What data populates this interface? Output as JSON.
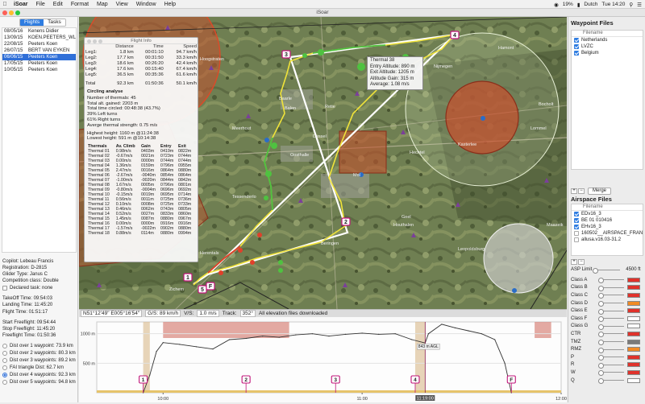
{
  "menubar": {
    "app": "iSoar",
    "items": [
      "File",
      "Edit",
      "Format",
      "Map",
      "View",
      "Window",
      "Help"
    ],
    "status": {
      "battery": "19%",
      "input": "Dutch",
      "clock": "Tue 14:20"
    }
  },
  "window": {
    "title": "iSoar"
  },
  "left": {
    "tabs": [
      "Flights",
      "Tasks"
    ],
    "active_tab": "Flights",
    "flights": [
      {
        "date": "08/05/16",
        "pilot": "Kenens Didier"
      },
      {
        "date": "13/09/15",
        "pilot": "KOEN.PEETERS_WL"
      },
      {
        "date": "22/08/15",
        "pilot": "Peeters Koen"
      },
      {
        "date": "26/07/15",
        "pilot": "BERT VAN EYKEN"
      },
      {
        "date": "06/06/15",
        "pilot": "Peeters Koen"
      },
      {
        "date": "17/05/15",
        "pilot": "Peeters Koen"
      },
      {
        "date": "10/05/15",
        "pilot": "Peeters Koen"
      }
    ],
    "selected_index": 4,
    "details": {
      "copilot": "Copilot: Lebeau Francis",
      "registration": "Registration: D-2815",
      "glider": "Glider Type: Janus C",
      "competition": "Competition class: Double",
      "declared": "Declared task: none",
      "takeoff": "TakeOff Time: 09:54:03",
      "landing": "Landing Time: 11:45:20",
      "flight_time": "Flight Time: 01:51:17",
      "start_ff": "Start Freeflight: 09:54:44",
      "stop_ff": "Stop Freeflight: 11:45:20",
      "ff_time": "Freeflight Time: 01:50:36"
    },
    "options": [
      {
        "label": "Dist over 1 waypoint: 73.9 km",
        "selected": false
      },
      {
        "label": "Dist over 2 waypoints: 80.3 km",
        "selected": false
      },
      {
        "label": "Dist over 3 waypoints: 89.2 km",
        "selected": false
      },
      {
        "label": "FAI triangle Dist: 62.7 km",
        "selected": false
      },
      {
        "label": "Dist over 4 waypoints: 92.3 km",
        "selected": true
      },
      {
        "label": "Dist over 5 waypoints: 94.8 km",
        "selected": false
      }
    ]
  },
  "flight_info": {
    "title": "Flight Info",
    "legs_header": [
      "",
      "Distance",
      "Time",
      "Speed"
    ],
    "legs": [
      [
        "Leg1:",
        "1.8 km",
        "00:01:10",
        "94.7 km/h"
      ],
      [
        "Leg2:",
        "17.7 km",
        "00:31:50",
        "33.3 km/h"
      ],
      [
        "Leg3:",
        "18.6 km",
        "00:26:20",
        "42.4 km/h"
      ],
      [
        "Leg4:",
        "17.6 km",
        "00:15:40",
        "67.4 km/h"
      ],
      [
        "Leg5:",
        "36.5 km",
        "00:35:36",
        "61.6 km/h"
      ]
    ],
    "total": [
      "Total",
      "92.3 km",
      "01:50:36",
      "50.1 km/h"
    ],
    "circling": {
      "heading": "Circling analyse",
      "lines": [
        "Number of thermals: 45",
        "Total alt. gained: 2203 m",
        "Total time circled: 00:48:38 (43.7%)",
        "39% Left turns",
        "61% Right turns",
        "Averge thermal strength: 0.75 m/s"
      ],
      "heights": [
        "Highest height: 1160 m @11:24:38",
        "Lowest height: 591 m @10:14:38"
      ]
    },
    "thermals_header": [
      "Thermals",
      "Av. Climb",
      "Gain",
      "Entry",
      "Exit"
    ],
    "thermals": [
      [
        "Thermal 01",
        "0.98m/s",
        "0403m",
        "0419m",
        "0822m"
      ],
      [
        "Thermal 02",
        "-0.67m/s",
        "0021m",
        "0723m",
        "0744m"
      ],
      [
        "Thermal 03",
        "0.00m/s",
        "0000m",
        "0744m",
        "0744m"
      ],
      [
        "Thermal 04",
        "1.36m/s",
        "0159m",
        "0796m",
        "0955m"
      ],
      [
        "Thermal 05",
        "2.47m/s",
        "0016m",
        "0864m",
        "0880m"
      ],
      [
        "Thermal 06",
        "-2.67m/s",
        "-0040m",
        "0854m",
        "0864m"
      ],
      [
        "Thermal 07",
        "-1.00m/s",
        "-0020m",
        "0844m",
        "0842m"
      ],
      [
        "Thermal 08",
        "1.67m/s",
        "0005m",
        "0796m",
        "0801m"
      ],
      [
        "Thermal 09",
        "-0.80m/s",
        "-0004m",
        "0696m",
        "0692m"
      ],
      [
        "Thermal 10",
        "-0.15m/s",
        "0019m",
        "0695m",
        "0714m"
      ],
      [
        "Thermal 11",
        "0.56m/s",
        "0011m",
        "0725m",
        "0736m"
      ],
      [
        "Thermal 12",
        "0.10m/s",
        "0008m",
        "0725m",
        "0733m"
      ],
      [
        "Thermal 13",
        "0.46m/s",
        "0062m",
        "0743m",
        "0805m"
      ],
      [
        "Thermal 14",
        "0.52m/s",
        "0027m",
        "0833m",
        "0860m"
      ],
      [
        "Thermal 15",
        "1.45m/s",
        "0087m",
        "0880m",
        "0967m"
      ],
      [
        "Thermal 16",
        "0.00m/s",
        "0000m",
        "0916m",
        "0916m"
      ],
      [
        "Thermal 17",
        "-1.57m/s",
        "-0022m",
        "0902m",
        "0880m"
      ],
      [
        "Thermal 18",
        "0.88m/s",
        "0114m",
        "0880m",
        "0994m"
      ]
    ]
  },
  "tooltip": {
    "lines": [
      "Thermal 38",
      "Entry Altitude: 890 m",
      "Exit Altitude: 1205 m",
      "Altitude Gain: 315 m",
      "Average: 1.08 m/s"
    ]
  },
  "map": {
    "labels": [
      "Baarle",
      "Nijmegen",
      "Hoogstraten",
      "Oosthalle",
      "Geel",
      "Meerhout",
      "Tessenderlo",
      "Zichem",
      "Beringen",
      "Balen",
      "Mol",
      "Dessel",
      "Retie",
      "Herentals",
      "Kasterlee",
      "Lommel",
      "Leopoldsburg",
      "Hamont",
      "Bocholt",
      "Hechtel",
      "Houthalen",
      "Maaseik"
    ],
    "turnpoints": [
      "1",
      "2",
      "3",
      "4",
      "5"
    ],
    "finish": "F",
    "zoom": [
      "+",
      "−"
    ]
  },
  "statusbar": {
    "coords": "N51°12'49\"  E005°16'54\"",
    "gs": "G/S: 89 km/h",
    "vis": "V/S:",
    "vs": "1.0 m/s",
    "track": "Track:",
    "track_val": "352°",
    "message": "All elevation files downloaded"
  },
  "profile": {
    "y_ticks": [
      "1000 m",
      "500 m"
    ],
    "x_ticks": [
      "10:00",
      "11:00",
      "12:00"
    ],
    "cursor_label": "11:19:00",
    "alt_label": "843 m AGL",
    "markers": [
      "1",
      "2",
      "3",
      "4",
      "F"
    ]
  },
  "chart_data": {
    "type": "line",
    "xlabel": "",
    "ylabel": "",
    "x_range": [
      "09:40",
      "12:00"
    ],
    "ylim": [
      0,
      1200
    ],
    "series": [
      {
        "x": [
          "09:54",
          "09:56",
          "09:58",
          "10:00",
          "10:05",
          "10:10",
          "10:15",
          "10:20",
          "10:25",
          "10:30",
          "10:35",
          "10:40",
          "10:45",
          "10:50",
          "10:55",
          "11:00",
          "11:05",
          "11:10",
          "11:15",
          "11:19",
          "11:20",
          "11:24",
          "11:28",
          "11:32",
          "11:36",
          "11:40",
          "11:43",
          "11:45"
        ],
        "values": [
          0,
          300,
          700,
          850,
          820,
          780,
          740,
          900,
          920,
          960,
          940,
          980,
          1000,
          960,
          990,
          1010,
          990,
          1000,
          900,
          843,
          1000,
          1160,
          1100,
          1050,
          1000,
          900,
          500,
          0
        ]
      }
    ]
  },
  "right": {
    "waypoint_title": "Waypoint Files",
    "waypoint_header": "Filename",
    "waypoint_files": [
      {
        "name": "Netherlands",
        "checked": true
      },
      {
        "name": "LVZC",
        "checked": true
      },
      {
        "name": "Belgium",
        "checked": true
      }
    ],
    "merge_label": "Merge",
    "airspace_title": "Airspace Files",
    "airspace_header": "Filename",
    "airspace_files": [
      {
        "name": "EDv16_3",
        "checked": true
      },
      {
        "name": "BE 01 010416",
        "checked": true
      },
      {
        "name": "EHv16_3",
        "checked": true
      },
      {
        "name": "160502__AIRSPACE_FRAN...",
        "checked": false
      },
      {
        "name": "allusa.v16.03-31.2",
        "checked": false
      }
    ],
    "asp_limit_label": "ASP Limit",
    "asp_limit_value": "4500 ft",
    "classes": [
      {
        "name": "Class A",
        "color": "#e0322b"
      },
      {
        "name": "Class B",
        "color": "#e0322b"
      },
      {
        "name": "Class C",
        "color": "#e0322b"
      },
      {
        "name": "Class D",
        "color": "#f08a24"
      },
      {
        "name": "Class E",
        "color": "#e0322b"
      },
      {
        "name": "Class F",
        "color": "#ffffff"
      },
      {
        "name": "Class G",
        "color": "#ffffff"
      },
      {
        "name": "CTR",
        "color": "#e0322b"
      },
      {
        "name": "TMZ",
        "color": "#7a7a7a"
      },
      {
        "name": "RMZ",
        "color": "#f08a24"
      },
      {
        "name": "P",
        "color": "#e0322b"
      },
      {
        "name": "R",
        "color": "#e0322b"
      },
      {
        "name": "W",
        "color": "#e0322b"
      },
      {
        "name": "Q",
        "color": "#ffffff"
      }
    ]
  }
}
